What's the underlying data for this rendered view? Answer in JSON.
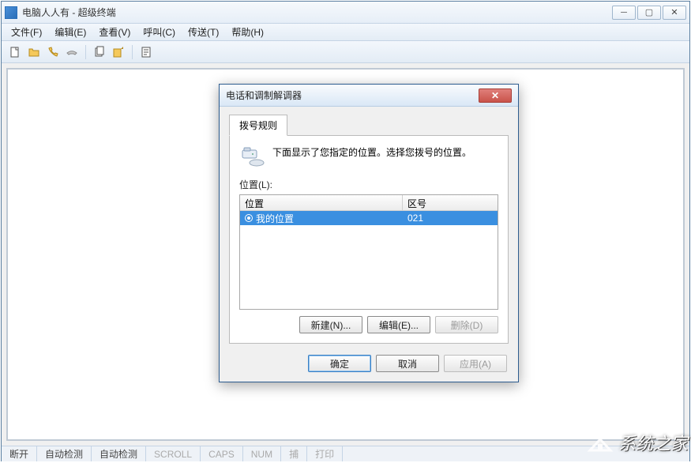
{
  "window": {
    "title": "电脑人人有 - 超级终端"
  },
  "menu": {
    "file": "文件(F)",
    "edit": "编辑(E)",
    "view": "查看(V)",
    "call": "呼叫(C)",
    "transfer": "传送(T)",
    "help": "帮助(H)"
  },
  "status": {
    "disconnected": "断开",
    "autodetect1": "自动检测",
    "autodetect2": "自动检测",
    "scroll": "SCROLL",
    "caps": "CAPS",
    "num": "NUM",
    "capture": "捕",
    "print": "打印"
  },
  "dialog": {
    "title": "电话和调制解调器",
    "tab": "拨号规则",
    "description": "下面显示了您指定的位置。选择您拨号的位置。",
    "location_label": "位置(L):",
    "columns": {
      "location": "位置",
      "area": "区号"
    },
    "rows": [
      {
        "name": "我的位置",
        "area_code": "021",
        "selected": true
      }
    ],
    "buttons": {
      "new": "新建(N)...",
      "edit": "编辑(E)...",
      "delete": "删除(D)",
      "ok": "确定",
      "cancel": "取消",
      "apply": "应用(A)"
    }
  },
  "watermark": {
    "text": "系统之家"
  }
}
